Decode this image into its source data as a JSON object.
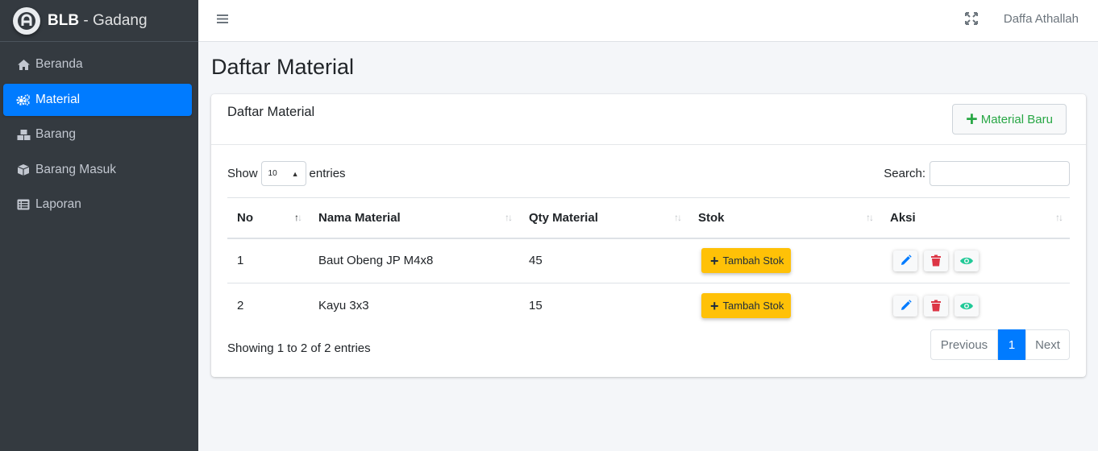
{
  "brand": {
    "bold": "BLB",
    "light": " - Gadang"
  },
  "sidebar": {
    "items": [
      {
        "label": "Beranda",
        "icon": "home-icon"
      },
      {
        "label": "Material",
        "icon": "cogs-icon",
        "active": true
      },
      {
        "label": "Barang",
        "icon": "cubes-icon"
      },
      {
        "label": "Barang Masuk",
        "icon": "box-icon"
      },
      {
        "label": "Laporan",
        "icon": "list-icon"
      }
    ]
  },
  "header": {
    "user": "Daffa Athallah"
  },
  "page": {
    "title": "Daftar Material"
  },
  "card": {
    "title": "Daftar Material",
    "new_button": "Material Baru",
    "show_label": "Show",
    "show_value": "10",
    "entries_label": "entries",
    "search_label": "Search:",
    "search_value": ""
  },
  "table": {
    "columns": [
      "No",
      "Nama Material",
      "Qty Material",
      "Stok",
      "Aksi"
    ],
    "rows": [
      {
        "no": "1",
        "name": "Baut Obeng JP M4x8",
        "qty": "45",
        "stok_button": "Tambah Stok"
      },
      {
        "no": "2",
        "name": "Kayu 3x3",
        "qty": "15",
        "stok_button": "Tambah Stok"
      }
    ]
  },
  "footer": {
    "info": "Showing 1 to 2 of 2 entries",
    "prev": "Previous",
    "current": "1",
    "next": "Next"
  },
  "colors": {
    "primary": "#007bff",
    "warning": "#ffc107",
    "success": "#28a745",
    "danger": "#dc3545",
    "sidebar": "#343a40"
  }
}
